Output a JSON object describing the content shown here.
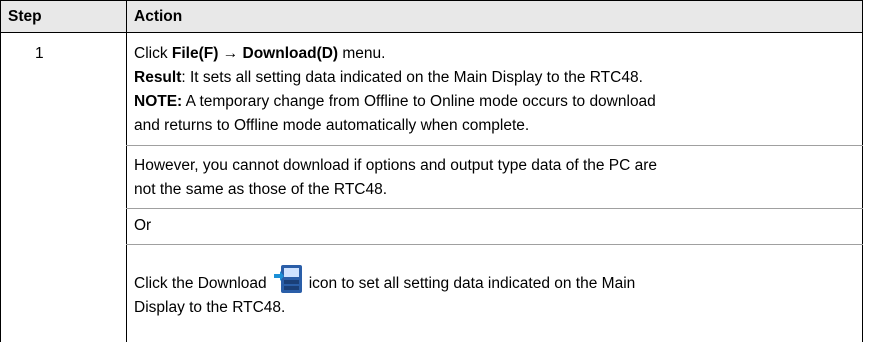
{
  "table": {
    "headers": {
      "step": "Step",
      "action": "Action"
    },
    "row": {
      "step": "1",
      "line1": {
        "prefix": "Click ",
        "menu_file": "File(F)",
        "arrow": " → ",
        "menu_download": "Download(D)",
        "suffix": " menu."
      },
      "result": {
        "label": "Result",
        "text": ": It sets all setting data indicated on the Main Display to the RTC48."
      },
      "note": {
        "label": "NOTE:",
        "line1": " A temporary change from Offline to Online mode occurs to download",
        "line2": "and returns to Offline mode automatically when complete."
      },
      "however": {
        "line1": "However, you cannot download if options and output type data of the PC are",
        "line2": "not the same as those of the RTC48."
      },
      "or": "Or",
      "icon_instruction": {
        "prefix": "Click the Download",
        "icon_name": "download-icon",
        "suffix": "icon to set all setting data indicated on the Main",
        "line2": "Display to the RTC48."
      }
    }
  }
}
